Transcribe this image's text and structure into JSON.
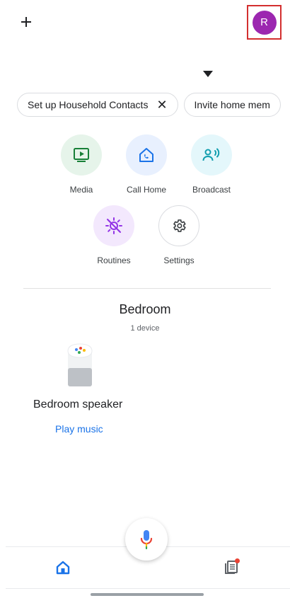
{
  "header": {
    "avatar_initial": "R",
    "avatar_color": "#9c27b0"
  },
  "chips": [
    {
      "label": "Set up Household Contacts",
      "close": "✕"
    },
    {
      "label": "Invite home mem"
    }
  ],
  "actions": [
    {
      "label": "Media",
      "icon": "media-icon",
      "bg": "#e6f4ea"
    },
    {
      "label": "Call Home",
      "icon": "call-home-icon",
      "bg": "#e8f0fe"
    },
    {
      "label": "Broadcast",
      "icon": "broadcast-icon",
      "bg": "#e4f7fb"
    },
    {
      "label": "Routines",
      "icon": "routines-icon",
      "bg": "#f3e8fd"
    },
    {
      "label": "Settings",
      "icon": "settings-icon",
      "bg": "#ffffff"
    }
  ],
  "room": {
    "title": "Bedroom",
    "subtitle": "1 device"
  },
  "device": {
    "name": "Bedroom speaker",
    "action": "Play music"
  },
  "colors": {
    "accent": "#1a73e8",
    "notification_dot": "#ea4335"
  }
}
